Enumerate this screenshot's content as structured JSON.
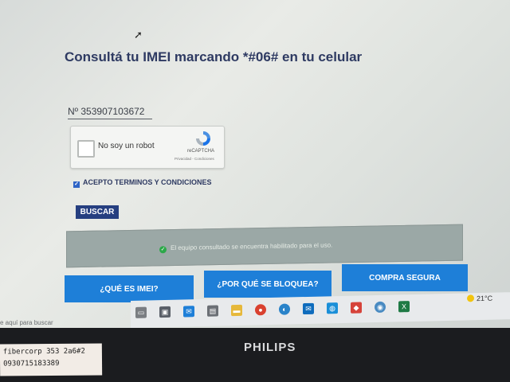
{
  "page": {
    "title": "Consultá tu IMEI marcando *#06# en tu celular",
    "imei_value": "Nº 353907103672",
    "captcha": {
      "label": "No soy un robot",
      "brand": "reCAPTCHA",
      "links": "Privacidad - Condiciones"
    },
    "terms_label": "ACEPTO TERMINOS Y CONDICIONES",
    "search_button": "BUSCAR",
    "status_message": "El equipo consultado se encuentra habilitado para el uso.",
    "buttons": {
      "what_is_imei": "¿QUÉ ES IMEI?",
      "why_blocked": "¿POR QUÉ SE BLOQUEA?",
      "secure_purchase": "COMPRA SEGURA"
    }
  },
  "taskbar": {
    "search_hint": "e aquí para buscar",
    "weather": "21°C",
    "icons": [
      "task-view-icon",
      "store-icon",
      "mail-icon",
      "calculator-icon",
      "folder-icon",
      "chrome-icon",
      "edge-icon",
      "outlook-icon",
      "app-icon",
      "anydesk-icon",
      "network-icon",
      "excel-icon"
    ],
    "colors": {
      "accent": "#1e7fd8",
      "navy": "#263f80"
    }
  },
  "monitor": {
    "brand": "PHILIPS",
    "sticker_line1": "fibercorp 353 2a6#2",
    "sticker_line2": "0930715183389"
  }
}
